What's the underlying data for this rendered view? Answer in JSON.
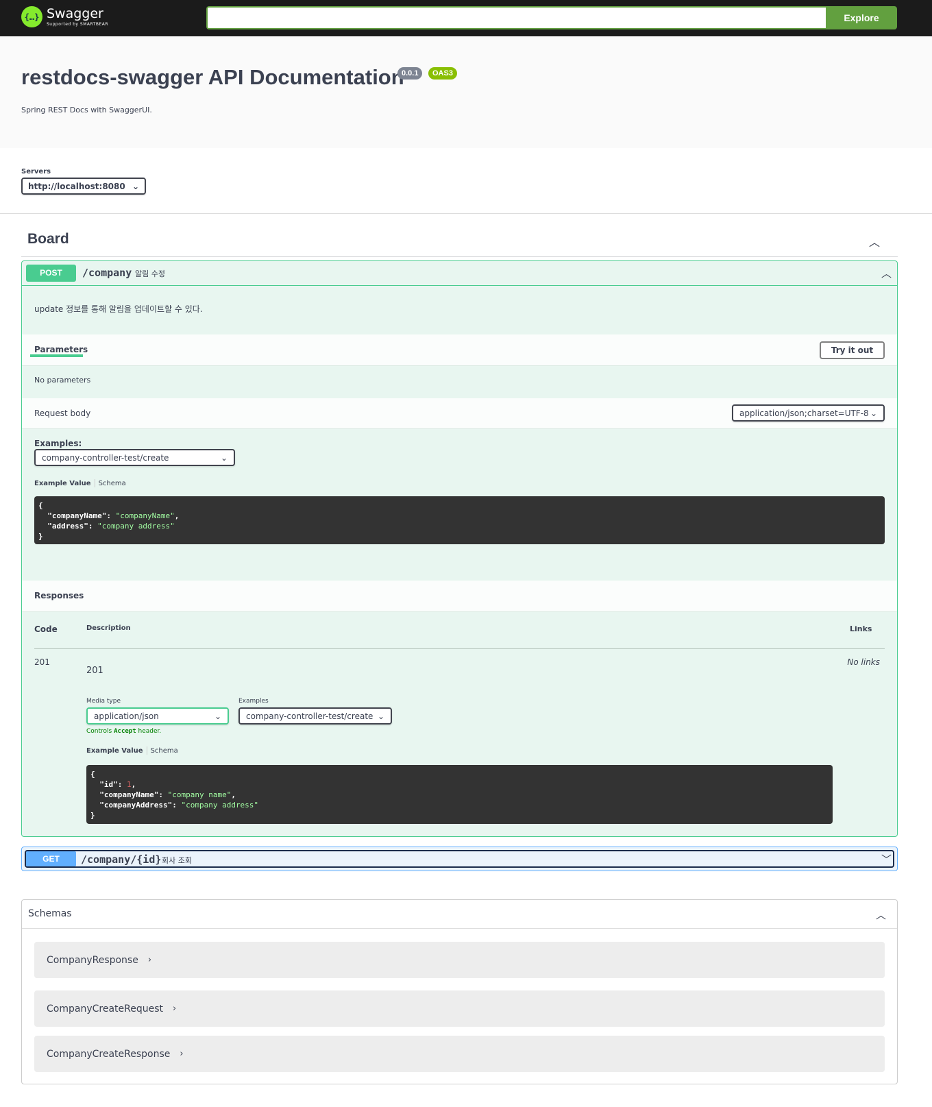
{
  "topbar": {
    "logo_name": "Swagger",
    "logo_sub": "Supported by SMARTBEAR",
    "search_value": "",
    "explore_label": "Explore"
  },
  "info": {
    "title": "restdocs-swagger API Documentation",
    "version_badge": "0.0.1",
    "oas_badge": "OAS3",
    "description": "Spring REST Docs with SwaggerUI."
  },
  "servers": {
    "label": "Servers",
    "selected": "http://localhost:8080"
  },
  "tag": {
    "title": "Board"
  },
  "post_op": {
    "method": "POST",
    "path": "/company",
    "summary": "알림 수정",
    "description": "update 정보를 통해 알림을 업데이트할 수 있다.",
    "parameters_tab": "Parameters",
    "try_it_out": "Try it out",
    "no_parameters": "No parameters",
    "request_body_label": "Request body",
    "content_type": "application/json;charset=UTF-8",
    "examples_label": "Examples:",
    "examples_selected": "company-controller-test/create",
    "example_value_tab": "Example Value",
    "schema_tab": "Schema",
    "request_example": {
      "open": "{",
      "k1": "\"companyName\"",
      "v1": "\"companyName\"",
      "k2": "\"address\"",
      "v2": "\"company address\"",
      "close": "}"
    },
    "responses_label": "Responses",
    "resp_headers": {
      "code": "Code",
      "description": "Description",
      "links": "Links"
    },
    "response": {
      "code": "201",
      "description": "201",
      "links": "No links",
      "media_type_label": "Media type",
      "media_type": "application/json",
      "examples_label": "Examples",
      "examples_selected": "company-controller-test/create",
      "controls_prefix": "Controls",
      "controls_code": "Accept",
      "controls_suffix": "header.",
      "example_value_tab": "Example Value",
      "schema_tab": "Schema",
      "example": {
        "open": "{",
        "k1": "\"id\"",
        "v1": "1",
        "k2": "\"companyName\"",
        "v2": "\"company name\"",
        "k3": "\"companyAddress\"",
        "v3": "\"company address\"",
        "close": "}"
      }
    }
  },
  "get_op": {
    "method": "GET",
    "path": "/company/{id}",
    "summary": "회사 조회"
  },
  "schemas": {
    "title": "Schemas",
    "items": [
      "CompanyResponse",
      "CompanyCreateRequest",
      "CompanyCreateResponse"
    ]
  },
  "colors": {
    "post": "#49cc90",
    "get": "#61affe",
    "explore": "#62a03f",
    "logo": "#85ea2d"
  }
}
